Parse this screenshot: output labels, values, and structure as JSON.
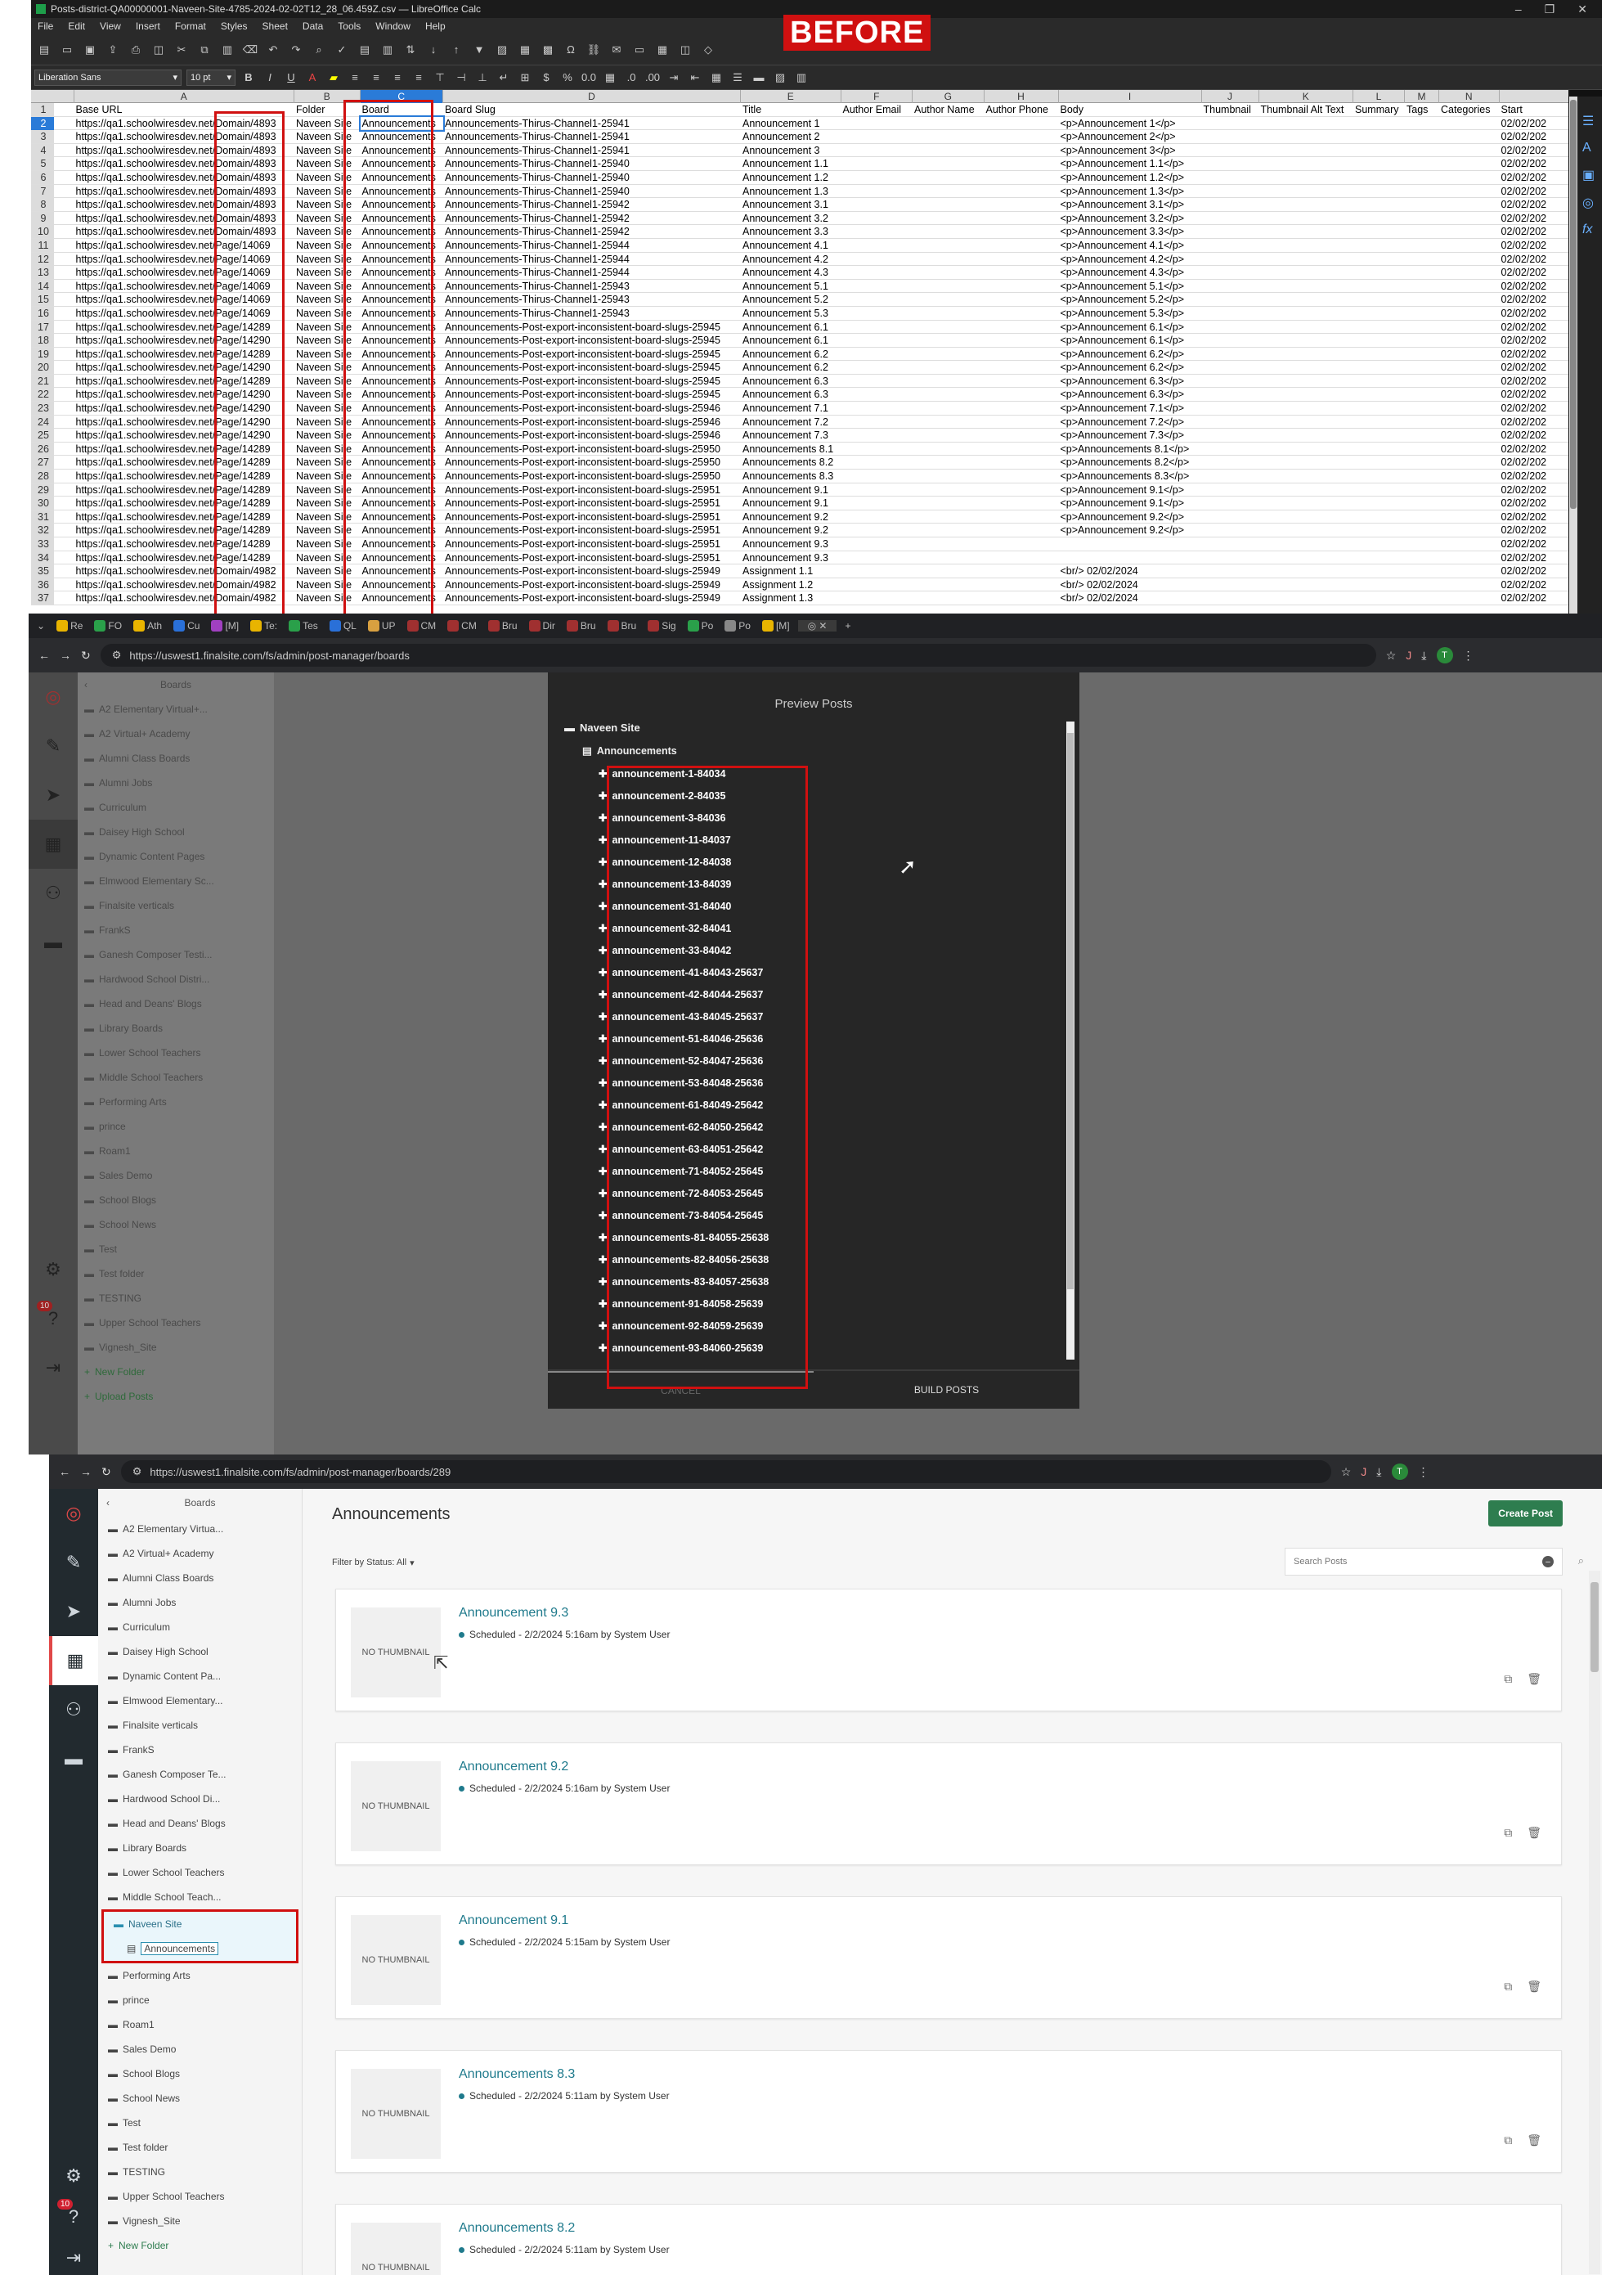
{
  "calc": {
    "title": "Posts-district-QA00000001-Naveen-Site-4785-2024-02-02T12_28_06.459Z.csv — LibreOffice Calc",
    "menu": [
      "File",
      "Edit",
      "View",
      "Insert",
      "Format",
      "Styles",
      "Sheet",
      "Data",
      "Tools",
      "Window",
      "Help"
    ],
    "font_name": "Liberation Sans",
    "font_size": "10 pt",
    "annotation": "BEFORE",
    "col_letters": [
      "A",
      "B",
      "C",
      "D",
      "E",
      "F",
      "G",
      "H",
      "I",
      "J",
      "K",
      "L",
      "M",
      "N"
    ],
    "headers": [
      "Base URL",
      "Folder",
      "Board",
      "Board Slug",
      "Title",
      "Author Email",
      "Author Name",
      "Author Phone",
      "Body",
      "Thumbnail",
      "Thumbnail Alt Text",
      "Summary",
      "Tags",
      "Categories",
      "Start"
    ],
    "rows": [
      {
        "n": "2",
        "a": "https://qa1.schoolwiresdev.net/Domain/4893",
        "b": "Naveen Site",
        "c": "Announcements",
        "d": "Announcements-Thirus-Channel1-25941",
        "e": "Announcement 1",
        "i": "<p>Announcement 1</p>",
        "o": "02/02/202"
      },
      {
        "n": "3",
        "a": "https://qa1.schoolwiresdev.net/Domain/4893",
        "b": "Naveen Site",
        "c": "Announcements",
        "d": "Announcements-Thirus-Channel1-25941",
        "e": "Announcement 2",
        "i": "<p>Announcement 2</p>",
        "o": "02/02/202"
      },
      {
        "n": "4",
        "a": "https://qa1.schoolwiresdev.net/Domain/4893",
        "b": "Naveen Site",
        "c": "Announcements",
        "d": "Announcements-Thirus-Channel1-25941",
        "e": "Announcement 3",
        "i": "<p>Announcement 3</p>",
        "o": "02/02/202"
      },
      {
        "n": "5",
        "a": "https://qa1.schoolwiresdev.net/Domain/4893",
        "b": "Naveen Site",
        "c": "Announcements",
        "d": "Announcements-Thirus-Channel1-25940",
        "e": "Announcement 1.1",
        "i": "<p>Announcement 1.1</p>",
        "o": "02/02/202"
      },
      {
        "n": "6",
        "a": "https://qa1.schoolwiresdev.net/Domain/4893",
        "b": "Naveen Site",
        "c": "Announcements",
        "d": "Announcements-Thirus-Channel1-25940",
        "e": "Announcement 1.2",
        "i": "<p>Announcement 1.2</p>",
        "o": "02/02/202"
      },
      {
        "n": "7",
        "a": "https://qa1.schoolwiresdev.net/Domain/4893",
        "b": "Naveen Site",
        "c": "Announcements",
        "d": "Announcements-Thirus-Channel1-25940",
        "e": "Announcement 1.3",
        "i": "<p>Announcement 1.3</p>",
        "o": "02/02/202"
      },
      {
        "n": "8",
        "a": "https://qa1.schoolwiresdev.net/Domain/4893",
        "b": "Naveen Site",
        "c": "Announcements",
        "d": "Announcements-Thirus-Channel1-25942",
        "e": "Announcement 3.1",
        "i": "<p>Announcement 3.1</p>",
        "o": "02/02/202"
      },
      {
        "n": "9",
        "a": "https://qa1.schoolwiresdev.net/Domain/4893",
        "b": "Naveen Site",
        "c": "Announcements",
        "d": "Announcements-Thirus-Channel1-25942",
        "e": "Announcement 3.2",
        "i": "<p>Announcement 3.2</p>",
        "o": "02/02/202"
      },
      {
        "n": "10",
        "a": "https://qa1.schoolwiresdev.net/Domain/4893",
        "b": "Naveen Site",
        "c": "Announcements",
        "d": "Announcements-Thirus-Channel1-25942",
        "e": "Announcement 3.3",
        "i": "<p>Announcement 3.3</p>",
        "o": "02/02/202"
      },
      {
        "n": "11",
        "a": "https://qa1.schoolwiresdev.net/Page/14069",
        "b": "Naveen Site",
        "c": "Announcements",
        "d": "Announcements-Thirus-Channel1-25944",
        "e": "Announcement 4.1",
        "i": "<p>Announcement 4.1</p>",
        "o": "02/02/202"
      },
      {
        "n": "12",
        "a": "https://qa1.schoolwiresdev.net/Page/14069",
        "b": "Naveen Site",
        "c": "Announcements",
        "d": "Announcements-Thirus-Channel1-25944",
        "e": "Announcement 4.2",
        "i": "<p>Announcement 4.2</p>",
        "o": "02/02/202"
      },
      {
        "n": "13",
        "a": "https://qa1.schoolwiresdev.net/Page/14069",
        "b": "Naveen Site",
        "c": "Announcements",
        "d": "Announcements-Thirus-Channel1-25944",
        "e": "Announcement 4.3",
        "i": "<p>Announcement 4.3</p>",
        "o": "02/02/202"
      },
      {
        "n": "14",
        "a": "https://qa1.schoolwiresdev.net/Page/14069",
        "b": "Naveen Site",
        "c": "Announcements",
        "d": "Announcements-Thirus-Channel1-25943",
        "e": "Announcement 5.1",
        "i": "<p>Announcement 5.1</p>",
        "o": "02/02/202"
      },
      {
        "n": "15",
        "a": "https://qa1.schoolwiresdev.net/Page/14069",
        "b": "Naveen Site",
        "c": "Announcements",
        "d": "Announcements-Thirus-Channel1-25943",
        "e": "Announcement 5.2",
        "i": "<p>Announcement 5.2</p>",
        "o": "02/02/202"
      },
      {
        "n": "16",
        "a": "https://qa1.schoolwiresdev.net/Page/14069",
        "b": "Naveen Site",
        "c": "Announcements",
        "d": "Announcements-Thirus-Channel1-25943",
        "e": "Announcement 5.3",
        "i": "<p>Announcement 5.3</p>",
        "o": "02/02/202"
      },
      {
        "n": "17",
        "a": "https://qa1.schoolwiresdev.net/Page/14289",
        "b": "Naveen Site",
        "c": "Announcements",
        "d": "Announcements-Post-export-inconsistent-board-slugs-25945",
        "e": "Announcement 6.1",
        "i": "<p>Announcement 6.1</p>",
        "o": "02/02/202"
      },
      {
        "n": "18",
        "a": "https://qa1.schoolwiresdev.net/Page/14290",
        "b": "Naveen Site",
        "c": "Announcements",
        "d": "Announcements-Post-export-inconsistent-board-slugs-25945",
        "e": "Announcement 6.1",
        "i": "<p>Announcement 6.1</p>",
        "o": "02/02/202"
      },
      {
        "n": "19",
        "a": "https://qa1.schoolwiresdev.net/Page/14289",
        "b": "Naveen Site",
        "c": "Announcements",
        "d": "Announcements-Post-export-inconsistent-board-slugs-25945",
        "e": "Announcement 6.2",
        "i": "<p>Announcement 6.2</p>",
        "o": "02/02/202"
      },
      {
        "n": "20",
        "a": "https://qa1.schoolwiresdev.net/Page/14290",
        "b": "Naveen Site",
        "c": "Announcements",
        "d": "Announcements-Post-export-inconsistent-board-slugs-25945",
        "e": "Announcement 6.2",
        "i": "<p>Announcement 6.2</p>",
        "o": "02/02/202"
      },
      {
        "n": "21",
        "a": "https://qa1.schoolwiresdev.net/Page/14289",
        "b": "Naveen Site",
        "c": "Announcements",
        "d": "Announcements-Post-export-inconsistent-board-slugs-25945",
        "e": "Announcement 6.3",
        "i": "<p>Announcement 6.3</p>",
        "o": "02/02/202"
      },
      {
        "n": "22",
        "a": "https://qa1.schoolwiresdev.net/Page/14290",
        "b": "Naveen Site",
        "c": "Announcements",
        "d": "Announcements-Post-export-inconsistent-board-slugs-25945",
        "e": "Announcement 6.3",
        "i": "<p>Announcement 6.3</p>",
        "o": "02/02/202"
      },
      {
        "n": "23",
        "a": "https://qa1.schoolwiresdev.net/Page/14290",
        "b": "Naveen Site",
        "c": "Announcements",
        "d": "Announcements-Post-export-inconsistent-board-slugs-25946",
        "e": "Announcement 7.1",
        "i": "<p>Announcement 7.1</p>",
        "o": "02/02/202"
      },
      {
        "n": "24",
        "a": "https://qa1.schoolwiresdev.net/Page/14290",
        "b": "Naveen Site",
        "c": "Announcements",
        "d": "Announcements-Post-export-inconsistent-board-slugs-25946",
        "e": "Announcement 7.2",
        "i": "<p>Announcement 7.2</p>",
        "o": "02/02/202"
      },
      {
        "n": "25",
        "a": "https://qa1.schoolwiresdev.net/Page/14290",
        "b": "Naveen Site",
        "c": "Announcements",
        "d": "Announcements-Post-export-inconsistent-board-slugs-25946",
        "e": "Announcement 7.3",
        "i": "<p>Announcement 7.3</p>",
        "o": "02/02/202"
      },
      {
        "n": "26",
        "a": "https://qa1.schoolwiresdev.net/Page/14289",
        "b": "Naveen Site",
        "c": "Announcements",
        "d": "Announcements-Post-export-inconsistent-board-slugs-25950",
        "e": "Announcements 8.1",
        "i": "<p>Announcements 8.1</p>",
        "o": "02/02/202"
      },
      {
        "n": "27",
        "a": "https://qa1.schoolwiresdev.net/Page/14289",
        "b": "Naveen Site",
        "c": "Announcements",
        "d": "Announcements-Post-export-inconsistent-board-slugs-25950",
        "e": "Announcements 8.2",
        "i": "<p>Announcements 8.2</p>",
        "o": "02/02/202"
      },
      {
        "n": "28",
        "a": "https://qa1.schoolwiresdev.net/Page/14289",
        "b": "Naveen Site",
        "c": "Announcements",
        "d": "Announcements-Post-export-inconsistent-board-slugs-25950",
        "e": "Announcements 8.3",
        "i": "<p>Announcements 8.3</p>",
        "o": "02/02/202"
      },
      {
        "n": "29",
        "a": "https://qa1.schoolwiresdev.net/Page/14289",
        "b": "Naveen Site",
        "c": "Announcements",
        "d": "Announcements-Post-export-inconsistent-board-slugs-25951",
        "e": "Announcement 9.1",
        "i": "<p>Announcement 9.1</p>",
        "o": "02/02/202"
      },
      {
        "n": "30",
        "a": "https://qa1.schoolwiresdev.net/Page/14289",
        "b": "Naveen Site",
        "c": "Announcements",
        "d": "Announcements-Post-export-inconsistent-board-slugs-25951",
        "e": "Announcement 9.1",
        "i": "<p>Announcement 9.1</p>",
        "o": "02/02/202"
      },
      {
        "n": "31",
        "a": "https://qa1.schoolwiresdev.net/Page/14289",
        "b": "Naveen Site",
        "c": "Announcements",
        "d": "Announcements-Post-export-inconsistent-board-slugs-25951",
        "e": "Announcement 9.2",
        "i": "<p>Announcement 9.2</p>",
        "o": "02/02/202"
      },
      {
        "n": "32",
        "a": "https://qa1.schoolwiresdev.net/Page/14289",
        "b": "Naveen Site",
        "c": "Announcements",
        "d": "Announcements-Post-export-inconsistent-board-slugs-25951",
        "e": "Announcement 9.2",
        "i": "<p>Announcement 9.2</p>",
        "o": "02/02/202"
      },
      {
        "n": "33",
        "a": "https://qa1.schoolwiresdev.net/Page/14289",
        "b": "Naveen Site",
        "c": "Announcements",
        "d": "Announcements-Post-export-inconsistent-board-slugs-25951",
        "e": "Announcement 9.3",
        "i": "",
        "o": "02/02/202"
      },
      {
        "n": "34",
        "a": "https://qa1.schoolwiresdev.net/Page/14289",
        "b": "Naveen Site",
        "c": "Announcements",
        "d": "Announcements-Post-export-inconsistent-board-slugs-25951",
        "e": "Announcement 9.3",
        "i": "",
        "o": "02/02/202"
      },
      {
        "n": "35",
        "a": "https://qa1.schoolwiresdev.net/Domain/4982",
        "b": "Naveen Site",
        "c": "Announcements",
        "d": "Announcements-Post-export-inconsistent-board-slugs-25949",
        "e": "Assignment 1.1",
        "i": "<br/> 02/02/2024",
        "o": "02/02/202"
      },
      {
        "n": "36",
        "a": "https://qa1.schoolwiresdev.net/Domain/4982",
        "b": "Naveen Site",
        "c": "Announcements",
        "d": "Announcements-Post-export-inconsistent-board-slugs-25949",
        "e": "Assignment 1.2",
        "i": "<br/> 02/02/2024",
        "o": "02/02/202"
      },
      {
        "n": "37",
        "a": "https://qa1.schoolwiresdev.net/Domain/4982",
        "b": "Naveen Site",
        "c": "Announcements",
        "d": "Announcements-Post-export-inconsistent-board-slugs-25949",
        "e": "Assignment 1.3",
        "i": "<br/> 02/02/2024",
        "o": "02/02/202"
      }
    ]
  },
  "browser": {
    "url": "https://uswest1.finalsite.com/fs/admin/post-manager/boards",
    "tabs": [
      "Re",
      "FO",
      "Ath",
      "Cu",
      "[M]",
      "Te:",
      "Tes",
      "QL",
      "UP",
      "CM",
      "CM",
      "Bru",
      "Dir",
      "Bru",
      "Bru",
      "Sig",
      "Po",
      "Po",
      "[M]"
    ]
  },
  "preview": {
    "boards_heading": "Boards",
    "boards": [
      "A2 Elementary Virtual+...",
      "A2 Virtual+ Academy",
      "Alumni Class Boards",
      "Alumni Jobs",
      "Curriculum",
      "Daisey High School",
      "Dynamic Content Pages",
      "Elmwood Elementary Sc...",
      "Finalsite verticals",
      "FrankS",
      "Ganesh Composer Testi...",
      "Hardwood School Distri...",
      "Head and Deans' Blogs",
      "Library Boards",
      "Lower School Teachers",
      "Middle School Teachers",
      "Performing Arts",
      "prince",
      "Roam1",
      "Sales Demo",
      "School Blogs",
      "School News",
      "Test",
      "Test folder",
      "TESTING",
      "Upper School Teachers",
      "Vignesh_Site"
    ],
    "new_folder": "New Folder",
    "upload_posts": "Upload Posts",
    "badge": "10",
    "modal_title": "Preview Posts",
    "site": "Naveen Site",
    "board": "Announcements",
    "posts": [
      "announcement-1-84034",
      "announcement-2-84035",
      "announcement-3-84036",
      "announcement-11-84037",
      "announcement-12-84038",
      "announcement-13-84039",
      "announcement-31-84040",
      "announcement-32-84041",
      "announcement-33-84042",
      "announcement-41-84043-25637",
      "announcement-42-84044-25637",
      "announcement-43-84045-25637",
      "announcement-51-84046-25636",
      "announcement-52-84047-25636",
      "announcement-53-84048-25636",
      "announcement-61-84049-25642",
      "announcement-62-84050-25642",
      "announcement-63-84051-25642",
      "announcement-71-84052-25645",
      "announcement-72-84053-25645",
      "announcement-73-84054-25645",
      "announcements-81-84055-25638",
      "announcements-82-84056-25638",
      "announcements-83-84057-25638",
      "announcement-91-84058-25639",
      "announcement-92-84059-25639",
      "announcement-93-84060-25639"
    ],
    "cancel": "CANCEL",
    "build": "BUILD POSTS"
  },
  "app": {
    "url": "https://uswest1.finalsite.com/fs/admin/post-manager/boards/289",
    "boards_heading": "Boards",
    "boards": [
      "A2 Elementary Virtua...",
      "A2 Virtual+ Academy",
      "Alumni Class Boards",
      "Alumni Jobs",
      "Curriculum",
      "Daisey High School",
      "Dynamic Content Pa...",
      "Elmwood Elementary...",
      "Finalsite verticals",
      "FrankS",
      "Ganesh Composer Te...",
      "Hardwood School Di...",
      "Head and Deans' Blogs",
      "Library Boards",
      "Lower School Teachers",
      "Middle School Teach..."
    ],
    "selected_folder": "Naveen Site",
    "selected_board": "Announcements",
    "boards_after": [
      "Performing Arts",
      "prince",
      "Roam1",
      "Sales Demo",
      "School Blogs",
      "School News",
      "Test",
      "Test folder",
      "TESTING",
      "Upper School Teachers",
      "Vignesh_Site"
    ],
    "new_folder": "New Folder",
    "badge": "10",
    "page_title": "Announcements",
    "create_post": "Create Post",
    "filter": "Filter by Status: All",
    "search_placeholder": "Search Posts",
    "no_thumb": "NO THUMBNAIL",
    "posts": [
      {
        "title": "Announcement 9.3",
        "meta": "Scheduled - 2/2/2024 5:16am by System User"
      },
      {
        "title": "Announcement 9.2",
        "meta": "Scheduled - 2/2/2024 5:16am by System User"
      },
      {
        "title": "Announcement 9.1",
        "meta": "Scheduled - 2/2/2024 5:15am by System User"
      },
      {
        "title": "Announcements 8.3",
        "meta": "Scheduled - 2/2/2024 5:11am by System User"
      },
      {
        "title": "Announcements 8.2",
        "meta": "Scheduled - 2/2/2024 5:11am by System User"
      }
    ]
  },
  "colors": {
    "highlight": "#d01010",
    "accent": "#1f7a8c",
    "create": "#2e7d4f"
  }
}
